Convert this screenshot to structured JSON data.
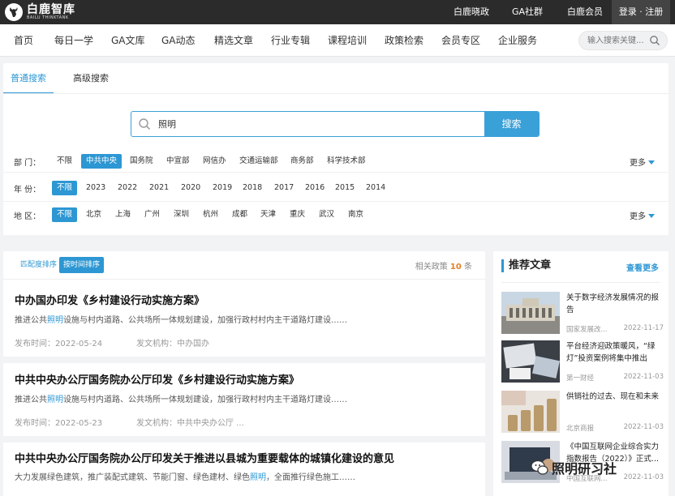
{
  "brand": {
    "name_cn": "白鹿智库",
    "name_en": "BAILU THINKTANK"
  },
  "topnav": [
    "白鹿晓政",
    "GA社群",
    "白鹿会员"
  ],
  "login_label": "登录 · 注册",
  "mainnav": [
    "首页",
    "每日一学",
    "GA文库",
    "GA动态",
    "精选文章",
    "行业专辑",
    "课程培训",
    "政策检索",
    "会员专区",
    "企业服务"
  ],
  "nav_search": {
    "placeholder": "输入搜索关键..."
  },
  "search_tabs": [
    "普通搜索",
    "高级搜索"
  ],
  "search": {
    "value": "照明",
    "button": "搜索"
  },
  "filters": {
    "dept": {
      "label": "部 门：",
      "options": [
        "不限",
        "中共中央",
        "国务院",
        "中宣部",
        "网信办",
        "交通运输部",
        "商务部",
        "科学技术部"
      ],
      "selected": "中共中央",
      "more": "更多"
    },
    "year": {
      "label": "年 份：",
      "options": [
        "不限",
        "2023",
        "2022",
        "2021",
        "2020",
        "2019",
        "2018",
        "2017",
        "2016",
        "2015",
        "2014"
      ],
      "selected": "不限"
    },
    "region": {
      "label": "地 区：",
      "options": [
        "不限",
        "北京",
        "上海",
        "广州",
        "深圳",
        "杭州",
        "成都",
        "天津",
        "重庆",
        "武汉",
        "南京"
      ],
      "selected": "不限",
      "more": "更多"
    }
  },
  "sort": {
    "relevance": "匹配度排序",
    "time": "按时间排序",
    "active": "time"
  },
  "result_count": {
    "prefix": "相关政策",
    "n": "10",
    "suffix": "条"
  },
  "results": [
    {
      "title": "中办国办印发《乡村建设行动实施方案》",
      "snippet_pre": "推进公共",
      "snippet_hl": "照明",
      "snippet_post": "设施与村内道路、公共场所一体规划建设，加强行政村村内主干道路灯建设……",
      "date_label": "发布时间：",
      "date": "2022-05-24",
      "org_label": "发文机构：",
      "org": "中办国办"
    },
    {
      "title": "中共中央办公厅国务院办公厅印发《乡村建设行动实施方案》",
      "snippet_pre": "推进公共",
      "snippet_hl": "照明",
      "snippet_post": "设施与村内道路、公共场所一体规划建设，加强行政村村内主干道路灯建设……",
      "date_label": "发布时间：",
      "date": "2022-05-23",
      "org_label": "发文机构：",
      "org": "中共中央办公厅 ..."
    },
    {
      "title": "中共中央办公厅国务院办公厅印发关于推进以县城为重要载体的城镇化建设的意见",
      "snippet_pre": "大力发展绿色建筑，推广装配式建筑、节能门窗、绿色建材、绿色",
      "snippet_hl": "照明",
      "snippet_post": "，全面推行绿色施工……"
    }
  ],
  "side": {
    "title": "推荐文章",
    "more": "查看更多",
    "articles": [
      {
        "title": "关于数字经济发展情况的报告",
        "source": "国家发展改...",
        "date": "2022-11-17"
      },
      {
        "title": "平台经济迎政策暖风，“绿灯”投资案例将集中推出",
        "source": "第一财经",
        "date": "2022-11-03"
      },
      {
        "title": "供销社的过去、现在和未来",
        "source": "北京商报",
        "date": "2022-11-03"
      },
      {
        "title": "《中国互联网企业综合实力指数报告（2022）》正式...",
        "source": "中国互联网...",
        "date": "2022-11-03"
      }
    ]
  },
  "watermark": "照明研习社"
}
